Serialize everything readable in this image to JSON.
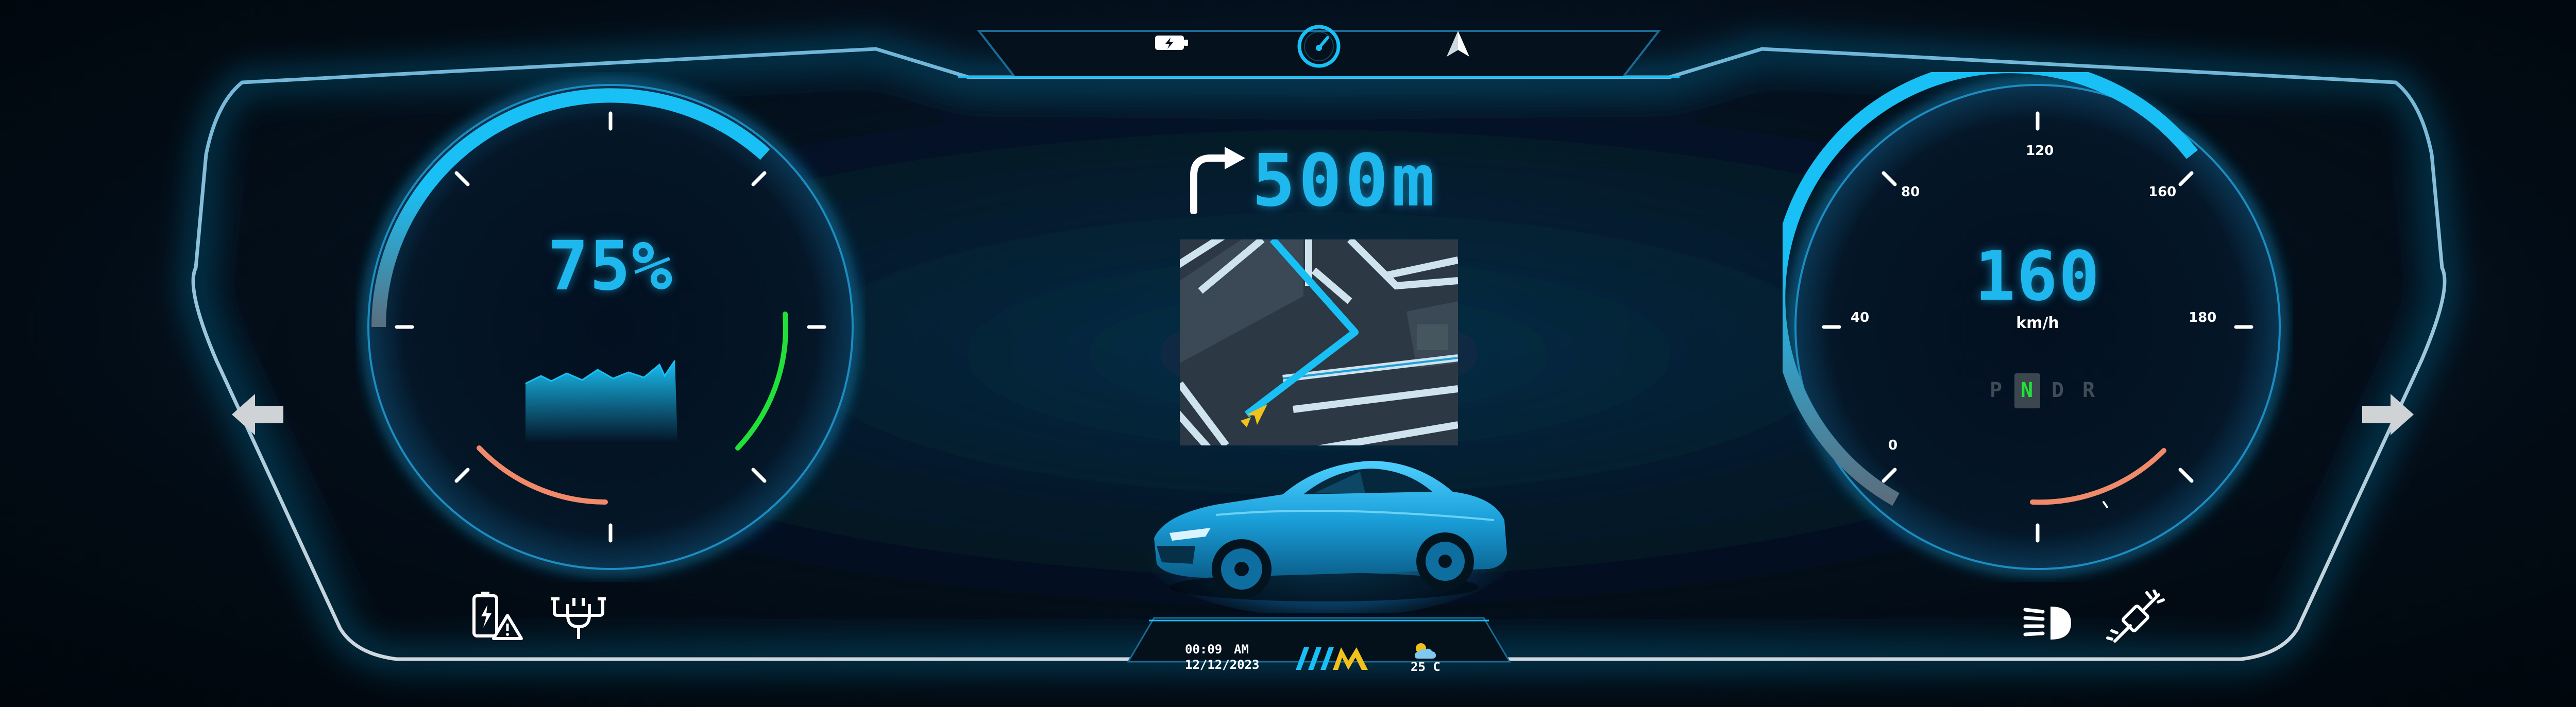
{
  "top_bar": {
    "icons": [
      "battery-charging-icon",
      "speedometer-icon",
      "navigation-arrow-icon"
    ],
    "active": "speedometer-icon"
  },
  "left_gauge": {
    "battery_percent_label": "75%",
    "battery_level": 0.75
  },
  "navigation": {
    "turn_direction": "right",
    "distance_label": "500m"
  },
  "right_gauge": {
    "speed_value": "160",
    "speed_unit": "km/h",
    "scale_labels": [
      "0",
      "40",
      "80",
      "120",
      "160",
      "180"
    ],
    "gears": [
      "P",
      "N",
      "D",
      "R"
    ],
    "selected_gear": "N"
  },
  "bottom_bar": {
    "time": "00:09",
    "ampm": "AM",
    "date": "12/12/2023",
    "temperature": "25 C"
  },
  "colors": {
    "accent": "#19c0f5",
    "green": "#22e03a",
    "orange": "#f08a6a",
    "text_blue": "#1eb8ee"
  }
}
